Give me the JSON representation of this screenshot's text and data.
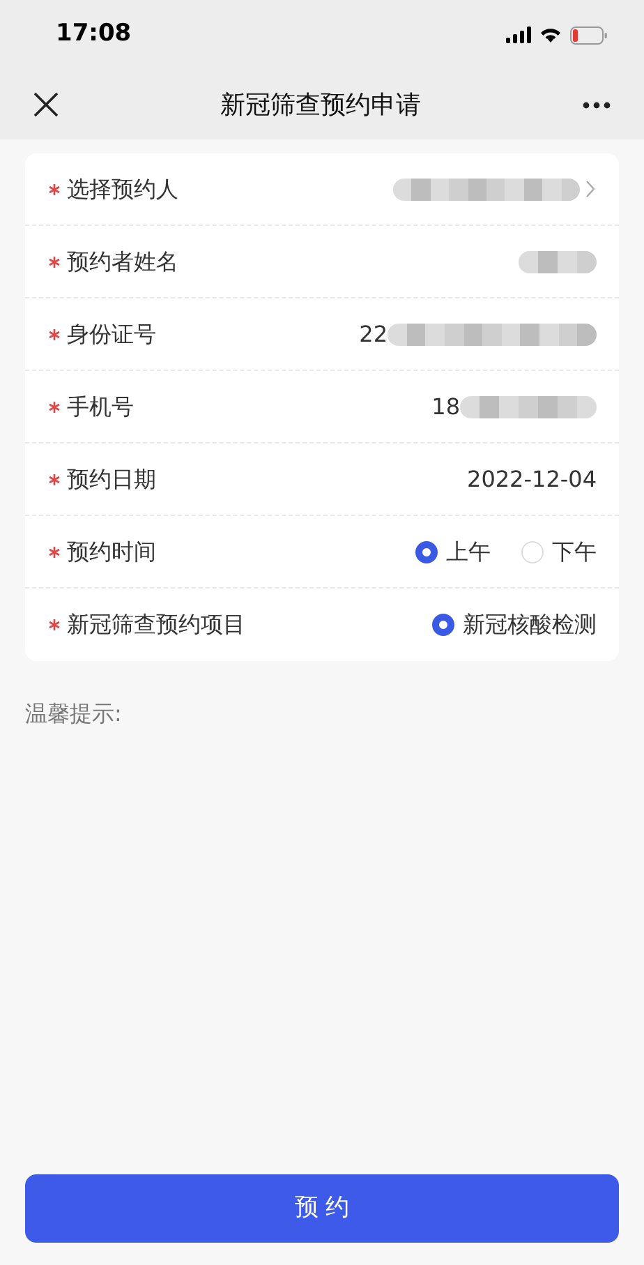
{
  "status_bar": {
    "time": "17:08"
  },
  "nav_bar": {
    "title": "新冠筛查预约申请"
  },
  "form": {
    "rows": [
      {
        "label": "选择预约人",
        "required": true,
        "kind": "picker"
      },
      {
        "label": "预约者姓名",
        "required": true,
        "kind": "redacted"
      },
      {
        "label": "身份证号",
        "required": true,
        "kind": "partial",
        "value": "22"
      },
      {
        "label": "手机号",
        "required": true,
        "kind": "partial",
        "value": "18"
      },
      {
        "label": "预约日期",
        "required": true,
        "kind": "value",
        "value": "2022-12-04"
      },
      {
        "label": "预约时间",
        "required": true,
        "kind": "radio",
        "options": [
          {
            "label": "上午",
            "selected": true
          },
          {
            "label": "下午",
            "selected": false
          }
        ]
      },
      {
        "label": "新冠筛查预约项目",
        "required": true,
        "kind": "radio",
        "options": [
          {
            "label": "新冠核酸检测",
            "selected": true
          }
        ]
      }
    ]
  },
  "tip": {
    "label": "温馨提示:"
  },
  "submit_button": {
    "label": "预 约"
  }
}
